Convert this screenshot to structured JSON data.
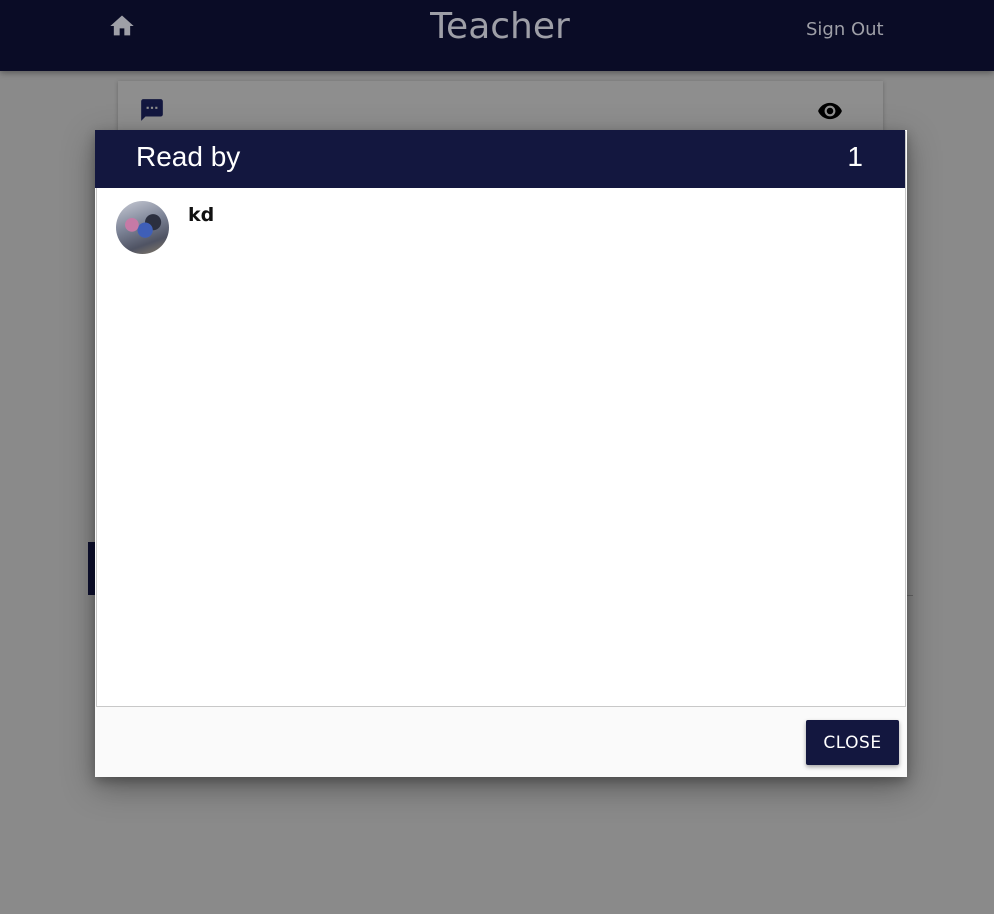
{
  "app_bar": {
    "title": "Teacher",
    "sign_out_label": "Sign Out",
    "home_icon": "home-icon"
  },
  "background_card": {
    "chat_icon": "chat-bubble-icon",
    "view_icon": "eye-icon"
  },
  "dialog": {
    "title": "Read by",
    "count": "1",
    "readers": [
      {
        "name": "kd",
        "avatar": "user-photo"
      }
    ],
    "close_label": "CLOSE"
  },
  "colors": {
    "app_bar_bg": "#0a0c26",
    "dialog_header_bg": "#13173f",
    "button_bg": "#13173f",
    "scrim": "#8a8a8a"
  }
}
